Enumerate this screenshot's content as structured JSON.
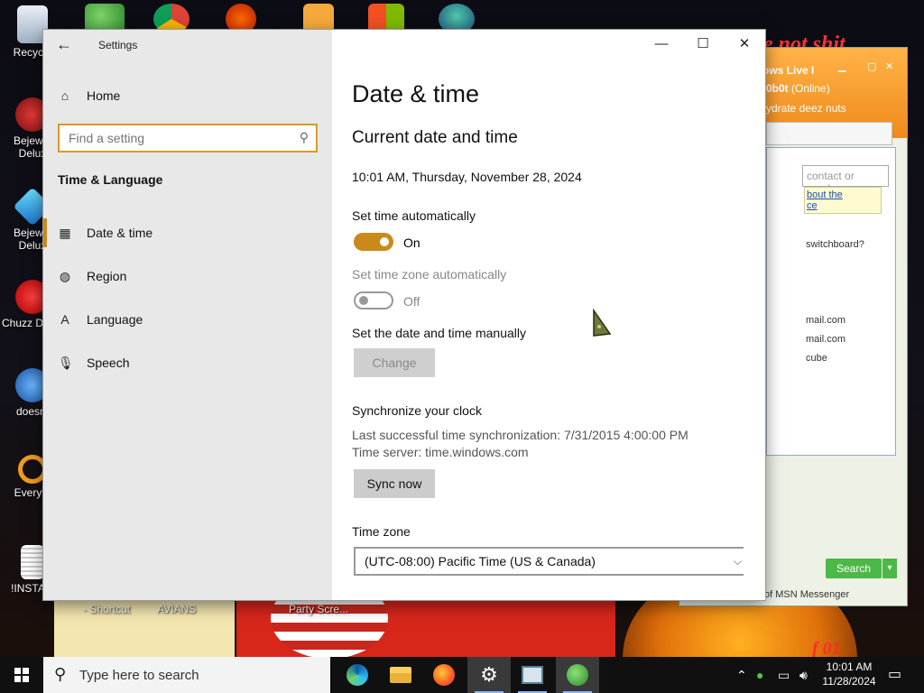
{
  "desktop": {
    "icons": [
      {
        "label": "Recycle",
        "icon": "recycle-bin-icon"
      },
      {
        "label": "Bejewel Delux",
        "icon": "bejeweled-icon"
      },
      {
        "label": "Bejewel Delux",
        "icon": "bejeweled-icon"
      },
      {
        "label": "Chuzz Delux",
        "icon": "chuzzle-icon"
      },
      {
        "label": "doesnt",
        "icon": "app-icon"
      },
      {
        "label": "Everyth",
        "icon": "everything-search-icon"
      },
      {
        "label": "!INSTALI",
        "icon": "installer-icon"
      }
    ],
    "bottom_labels": [
      "- Shortcut",
      "AVIANS",
      "Party Scre..."
    ],
    "scrawl": "e not shit",
    "wall_text": "f 01"
  },
  "msn": {
    "title": "ows Live I",
    "user": "0b0t",
    "status": "(Online)",
    "message": "ydrate deez nuts",
    "search_placeholder": "contact or numbe",
    "link_text": "bout the",
    "link_text2": "ce",
    "rows": [
      "switchboard?",
      "mail.com",
      "mail.com",
      "cube"
    ],
    "search_label": "Search",
    "footer": "of MSN Messenger"
  },
  "settings": {
    "window_title": "Settings",
    "nav": {
      "home": "Home",
      "search_placeholder": "Find a setting",
      "section": "Time & Language",
      "items": [
        {
          "label": "Date & time",
          "icon": "calendar-clock-icon",
          "active": true
        },
        {
          "label": "Region",
          "icon": "globe-icon",
          "active": false
        },
        {
          "label": "Language",
          "icon": "language-icon",
          "active": false
        },
        {
          "label": "Speech",
          "icon": "microphone-icon",
          "active": false
        }
      ]
    },
    "content": {
      "title": "Date & time",
      "current_heading": "Current date and time",
      "current_value": "10:01 AM, Thursday, November 28, 2024",
      "set_time_auto_label": "Set time automatically",
      "set_time_auto_state": "On",
      "set_tz_auto_label": "Set time zone automatically",
      "set_tz_auto_state": "Off",
      "manual_label": "Set the date and time manually",
      "change_button": "Change",
      "sync_heading": "Synchronize your clock",
      "sync_last": "Last successful time synchronization: 7/31/2015 4:00:00 PM",
      "sync_server": "Time server: time.windows.com",
      "sync_button": "Sync now",
      "timezone_label": "Time zone",
      "timezone_value": "(UTC-08:00) Pacific Time (US & Canada)"
    }
  },
  "taskbar": {
    "search_placeholder": "Type here to search",
    "apps": [
      "edge",
      "file-explorer",
      "firefox",
      "settings",
      "task-view-app",
      "msn-messenger"
    ],
    "time": "10:01 AM",
    "date": "11/28/2024"
  },
  "colors": {
    "accent": "#c98a1a",
    "sidebar_bg": "#e8e8e8",
    "msn_orange": "#f08a1c"
  }
}
